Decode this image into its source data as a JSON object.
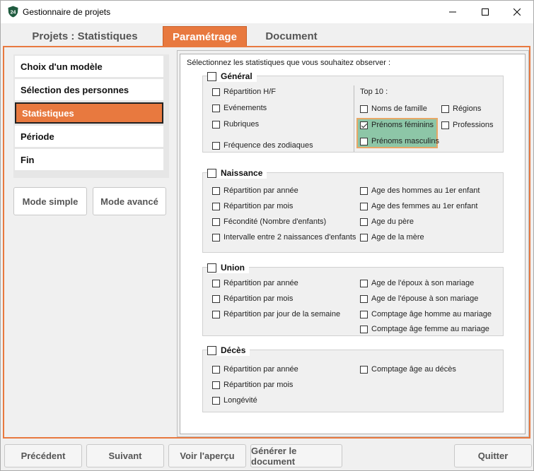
{
  "window": {
    "title": "Gestionnaire de projets",
    "app_icon_text": "24"
  },
  "tabs": [
    "Projets : Statistiques",
    "Paramétrage",
    "Document"
  ],
  "steps": [
    "Choix d'un modèle",
    "Sélection des personnes",
    "Statistiques",
    "Période",
    "Fin"
  ],
  "mode_buttons": [
    "Mode simple",
    "Mode avancé"
  ],
  "instruction": "Sélectionnez les statistiques que vous souhaitez observer :",
  "groups": {
    "general": {
      "title": "Général",
      "left": [
        "Répartition H/F",
        "Evénements",
        "Rubriques",
        "Fréquence des zodiaques"
      ],
      "top10_label": "Top 10 :",
      "top10": [
        "Noms de famille",
        "Prénoms féminins",
        "Prénoms masculins"
      ],
      "right": [
        "Régions",
        "Professions"
      ]
    },
    "naissance": {
      "title": "Naissance",
      "left": [
        "Répartition par année",
        "Répartition par mois",
        "Fécondité (Nombre d'enfants)",
        "Intervalle entre 2 naissances d'enfants"
      ],
      "right": [
        "Age des hommes au 1er enfant",
        "Age des femmes au 1er enfant",
        "Age du père",
        "Age de la mère"
      ]
    },
    "union": {
      "title": "Union",
      "left": [
        "Répartition par année",
        "Répartition par mois",
        "Répartition par jour de la semaine"
      ],
      "right": [
        "Age de l'époux à son mariage",
        "Age de l'épouse à son mariage",
        "Comptage âge homme au mariage",
        "Comptage âge femme au mariage"
      ]
    },
    "deces": {
      "title": "Décès",
      "left": [
        "Répartition par année",
        "Répartition par mois",
        "Longévité"
      ],
      "right": [
        "Comptage âge au décès"
      ]
    }
  },
  "footer": [
    "Précédent",
    "Suivant",
    "Voir l'aperçu",
    "Générer le document",
    "Quitter"
  ],
  "colors": {
    "accent": "#e8793f",
    "highlight": "#8dc6a7",
    "highlight_border": "#e8a766"
  }
}
